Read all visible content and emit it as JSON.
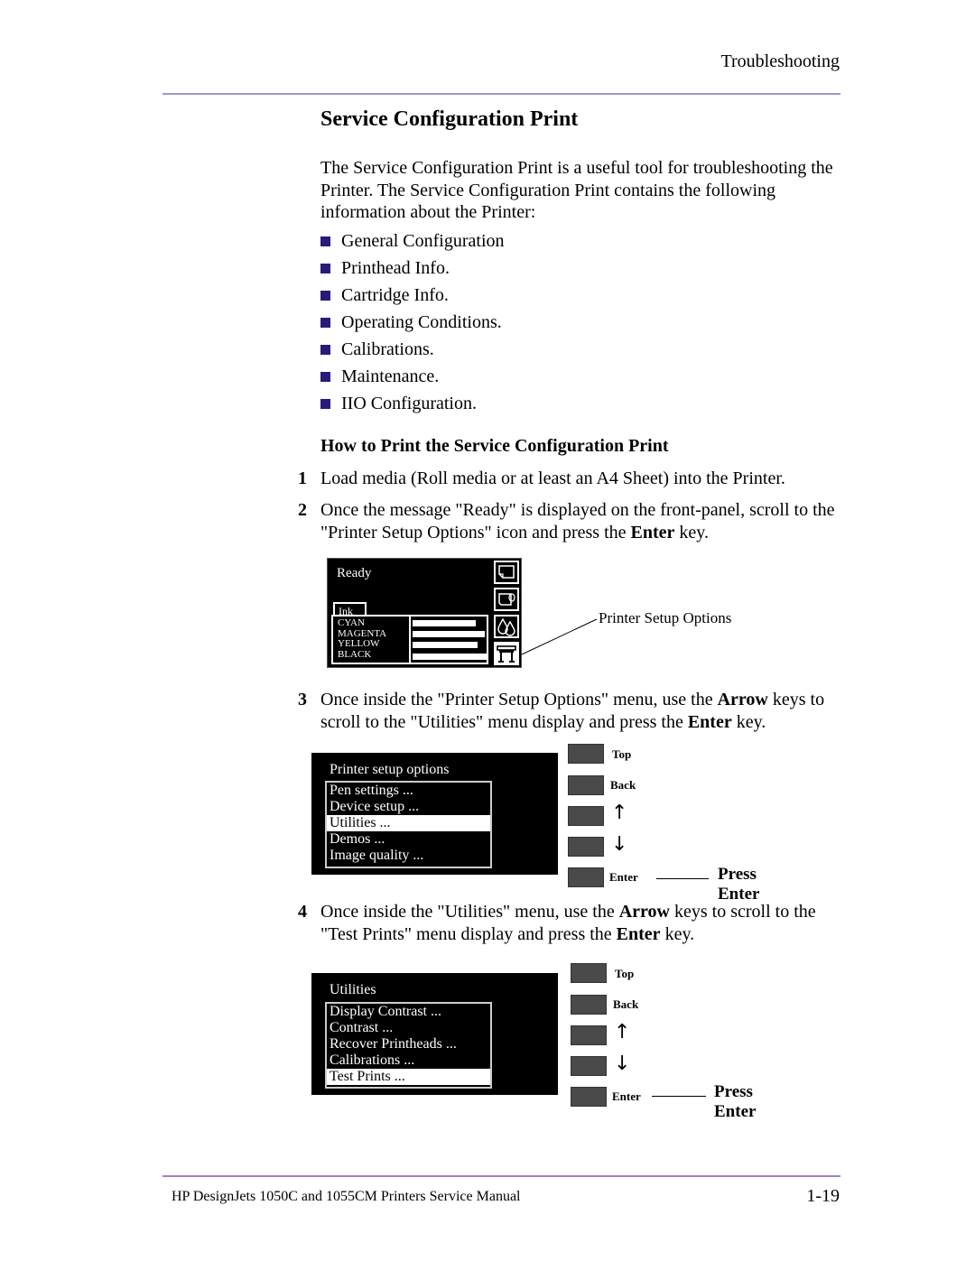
{
  "header": {
    "running_head": "Troubleshooting"
  },
  "section": {
    "title": "Service Configuration Print",
    "intro": "The Service Configuration Print is a useful tool for troubleshooting the Printer. The Service Configuration Print contains the following information about the Printer:",
    "bullets": [
      "General Configuration",
      "Printhead Info.",
      "Cartridge Info.",
      "Operating Conditions.",
      "Calibrations.",
      "Maintenance.",
      "IIO Configuration."
    ],
    "bullet_color": "#2b1a7a"
  },
  "howto": {
    "heading": "How to Print the Service Configuration Print",
    "steps": [
      {
        "num": "1",
        "parts": [
          "Load media (Roll media or at least an A4 Sheet) into the Printer."
        ]
      },
      {
        "num": "2",
        "pre": "Once the message \"Ready\" is displayed on the front-panel, scroll to the \"Printer Setup Options\" icon and press the ",
        "bold": "Enter",
        "post": " key."
      },
      {
        "num": "3",
        "pre": "Once inside the \"Printer Setup Options\" menu, use the ",
        "bold": "Arrow",
        "mid": " keys to scroll to the \"Utilities\" menu display and press the ",
        "bold2": "Enter",
        "post": " key."
      },
      {
        "num": "4",
        "pre": "Once inside the \"Utilities\" menu, use the ",
        "bold": "Arrow",
        "mid": " keys to scroll to the \"Test Prints\" menu display and press the ",
        "bold2": "Enter",
        "post": " key."
      }
    ]
  },
  "ready_panel": {
    "status": "Ready",
    "ink_tab": "Ink",
    "inks": [
      {
        "name": "CYAN",
        "level": 0.85
      },
      {
        "name": "MAGENTA",
        "level": 0.98
      },
      {
        "name": "YELLOW",
        "level": 0.88
      },
      {
        "name": "BLACK",
        "level": 1.0
      }
    ],
    "icons": [
      "sheet-media-icon",
      "roll-media-icon",
      "ink-drops-icon",
      "printer-setup-icon"
    ],
    "callout": "Printer Setup Options"
  },
  "setup_menu": {
    "title": "Printer setup options",
    "items": [
      "Pen settings ...",
      "Device setup ...",
      "Utilities ...",
      "Demos ...",
      "Image quality ..."
    ],
    "selected_index": 2
  },
  "utilities_menu": {
    "title": "Utilities",
    "items": [
      "Display Contrast ...",
      "Contrast ...",
      "Recover Printheads ...",
      "Calibrations ...",
      "Test Prints ..."
    ],
    "selected_index": 4
  },
  "keys": {
    "top": "Top",
    "back": "Back",
    "up": "↑",
    "down": "↓",
    "enter": "Enter",
    "press_enter": "Press Enter"
  },
  "footer": {
    "manual_title": "HP DesignJets 1050C and 1055CM Printers Service Manual",
    "page_number": "1-19"
  }
}
